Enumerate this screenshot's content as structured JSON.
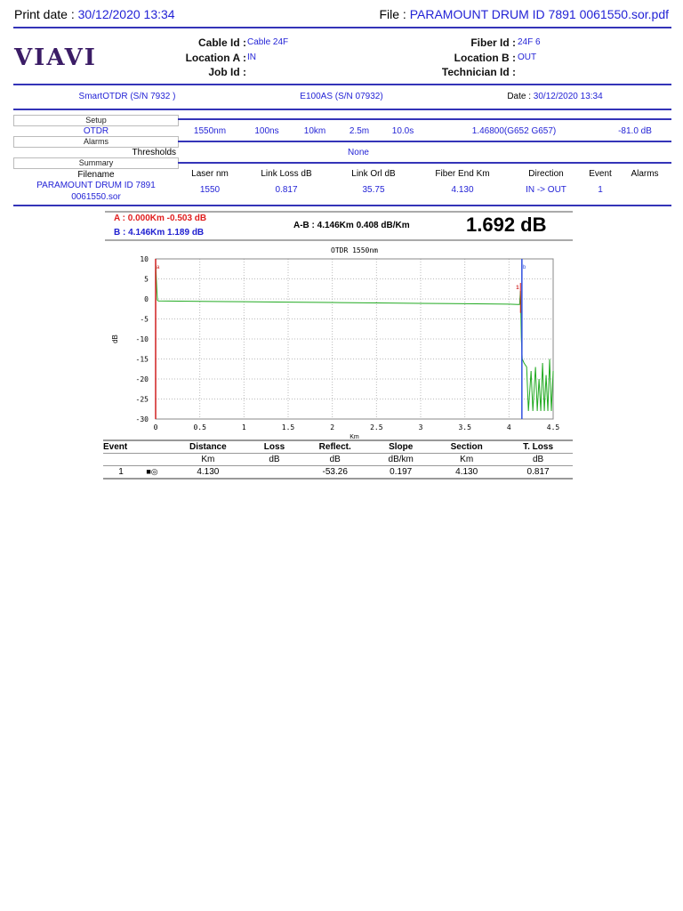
{
  "header": {
    "print_date_label": "Print date : ",
    "print_date": "30/12/2020 13:34",
    "file_label": "File : ",
    "file": "PARAMOUNT DRUM ID 7891 0061550.sor.pdf"
  },
  "logo": "VIAVI",
  "info": {
    "cable_id_label": "Cable Id : ",
    "cable_id": "Cable 24F",
    "location_a_label": "Location A : ",
    "location_a": "IN",
    "job_id_label": "Job Id :",
    "fiber_id_label": "Fiber Id : ",
    "fiber_id": "24F 6",
    "location_b_label": "Location B : ",
    "location_b": "OUT",
    "technician_id_label": "Technician Id :"
  },
  "device": {
    "model": "SmartOTDR (S/N 7932 )",
    "module": "E100AS (S/N 07932)",
    "date_label": "Date : ",
    "date": "30/12/2020 13:34"
  },
  "setup": {
    "setup_label": "Setup",
    "otdr_label": "OTDR",
    "wavelength": "1550nm",
    "pulse": "100ns",
    "range": "10km",
    "resolution": "2.5m",
    "time": "10.0s",
    "ior": "1.46800(G652 G657)",
    "threshold": "-81.0 dB"
  },
  "alarms": {
    "alarms_label": "Alarms",
    "thresholds_label": "Thresholds",
    "thresholds_value": "None"
  },
  "summary": {
    "summary_label": "Summary",
    "filename_label": "Filename",
    "filename_line1": "PARAMOUNT DRUM ID 7891",
    "filename_line2": "0061550.sor",
    "headers": [
      "Laser nm",
      "Link Loss dB",
      "Link Orl dB",
      "Fiber End Km",
      "Direction",
      "Event",
      "Alarms"
    ],
    "values": [
      "1550",
      "0.817",
      "35.75",
      "4.130",
      "IN -> OUT",
      "1",
      ""
    ]
  },
  "markers": {
    "a": "A : 0.000Km -0.503 dB",
    "b": "B : 4.146Km 1.189 dB",
    "ab": "A-B : 4.146Km 0.408 dB/Km",
    "loss": "1.692 dB"
  },
  "chart_data": {
    "type": "line",
    "title": "OTDR 1550nm",
    "xlabel": "Km",
    "ylabel": "dB",
    "xlim": [
      0,
      4.5
    ],
    "ylim": [
      -30,
      10
    ],
    "xticks": [
      "0",
      "0.5",
      "1",
      "1.5",
      "2",
      "2.5",
      "3",
      "3.5",
      "4",
      "4.5"
    ],
    "yticks": [
      "10",
      "5",
      "0",
      "-5",
      "-10",
      "-15",
      "-20",
      "-25",
      "-30"
    ],
    "grid": true,
    "cursor_a_km": 0,
    "cursor_b_km": 4.146,
    "event_marker": {
      "label": "1",
      "km": 4.13
    },
    "series": [
      {
        "name": "trace",
        "color": "#22aa22",
        "x": [
          0,
          0.01,
          0.02,
          0.03,
          0.5,
          1.0,
          1.5,
          2.0,
          2.5,
          3.0,
          3.5,
          4.0,
          4.1,
          4.12,
          4.13,
          4.14,
          4.15,
          4.17,
          4.2,
          4.22,
          4.25,
          4.27,
          4.3,
          4.32,
          4.34,
          4.36,
          4.38,
          4.4,
          4.42,
          4.44,
          4.46,
          4.48,
          4.5
        ],
        "y": [
          9,
          4,
          -0.3,
          -0.5,
          -0.6,
          -0.7,
          -0.8,
          -0.9,
          -1.0,
          -1.1,
          -1.2,
          -1.3,
          -1.4,
          -1.4,
          2.0,
          -10,
          -15,
          -16,
          -17,
          -28,
          -18,
          -28,
          -17,
          -28,
          -20,
          -28,
          -16,
          -28,
          -19,
          -28,
          -15,
          -28,
          -18
        ]
      }
    ]
  },
  "events_table": {
    "headers": [
      "Event",
      "Distance",
      "Loss",
      "Reflect.",
      "Slope",
      "Section",
      "T. Loss"
    ],
    "units": [
      "",
      "Km",
      "dB",
      "dB",
      "dB/km",
      "Km",
      "dB"
    ],
    "rows": [
      {
        "event": "1",
        "distance": "4.130",
        "loss": "",
        "reflect": "-53.26",
        "slope": "0.197",
        "section": "4.130",
        "tloss": "0.817"
      }
    ]
  }
}
